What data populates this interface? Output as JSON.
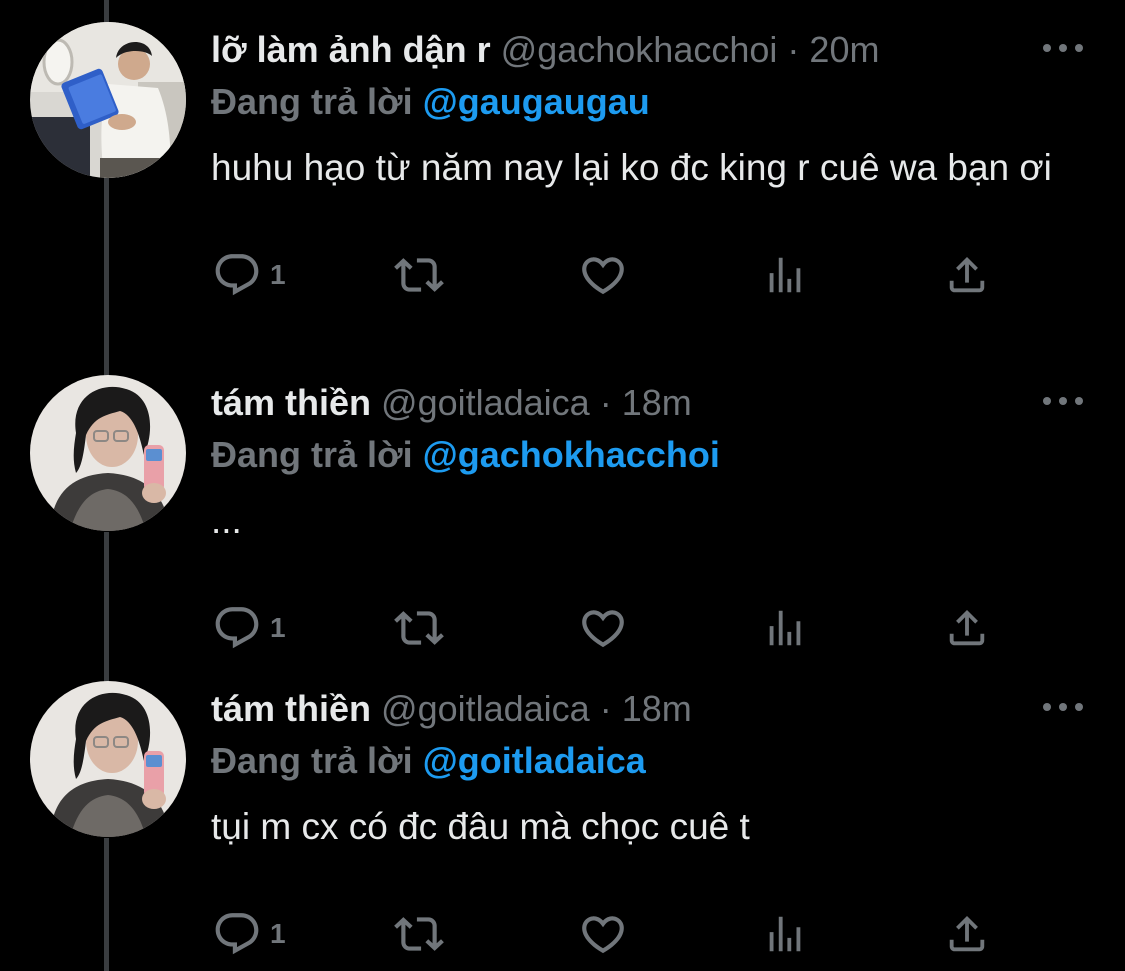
{
  "colors": {
    "background": "#000000",
    "text": "#e7e9ea",
    "muted": "#71767b",
    "accent": "#1d9bf0",
    "thread_line": "#3a3d40"
  },
  "tweets": [
    {
      "display_name": "lỡ làm ảnh dận r",
      "handle": "@gachokhacchoi",
      "separator": "·",
      "time": "20m",
      "reply_prefix": "Đang trả lời",
      "reply_to": "@gaugaugau",
      "text": "huhu hạo từ năm nay lại ko đc king r cuê wa bạn ơi",
      "reply_count": "1",
      "avatar_icon": "avatar-reading-on-plane"
    },
    {
      "display_name": "tám thiền",
      "handle": "@goitladaica",
      "separator": "·",
      "time": "18m",
      "reply_prefix": "Đang trả lời",
      "reply_to": "@gachokhacchoi",
      "text": "...",
      "reply_count": "1",
      "avatar_icon": "avatar-mirror-selfie"
    },
    {
      "display_name": "tám thiền",
      "handle": "@goitladaica",
      "separator": "·",
      "time": "18m",
      "reply_prefix": "Đang trả lời",
      "reply_to": "@goitladaica",
      "text": "tụi m cx có đc đâu mà chọc cuê t",
      "reply_count": "1",
      "avatar_icon": "avatar-mirror-selfie"
    }
  ],
  "action_icons": [
    "reply-icon",
    "retweet-icon",
    "like-icon",
    "analytics-icon",
    "share-icon"
  ]
}
